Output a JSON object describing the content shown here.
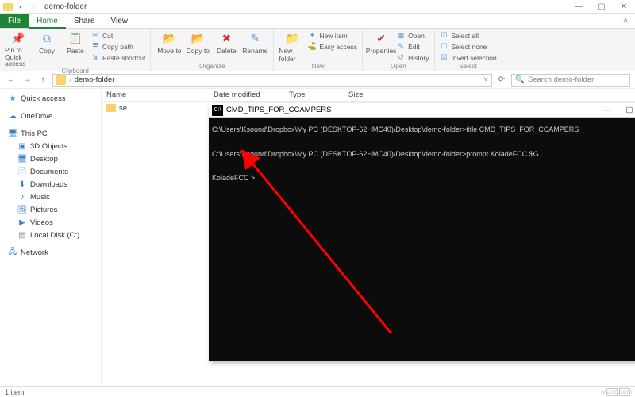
{
  "window": {
    "title": "demo-folder"
  },
  "ribbon": {
    "tabs": {
      "file": "File",
      "home": "Home",
      "share": "Share",
      "view": "View"
    },
    "clipboard": {
      "pin": "Pin to Quick access",
      "copy": "Copy",
      "paste": "Paste",
      "cut": "Cut",
      "copy_path": "Copy path",
      "paste_shortcut": "Paste shortcut",
      "label": "Clipboard"
    },
    "organize": {
      "move": "Move to",
      "copy": "Copy to",
      "delete": "Delete",
      "rename": "Rename",
      "label": "Organize"
    },
    "new": {
      "folder": "New folder",
      "item": "New item",
      "easy": "Easy access",
      "label": "New"
    },
    "open": {
      "properties": "Properties",
      "open": "Open",
      "edit": "Edit",
      "history": "History",
      "label": "Open"
    },
    "select": {
      "all": "Select all",
      "none": "Select none",
      "invert": "Invert selection",
      "label": "Select"
    }
  },
  "address": {
    "path": "demo-folder",
    "search_placeholder": "Search demo-folder"
  },
  "columns": {
    "name": "Name",
    "date": "Date modified",
    "type": "Type",
    "size": "Size"
  },
  "nav": {
    "quick": "Quick access",
    "onedrive": "OneDrive",
    "pc": "This PC",
    "items": [
      "3D Objects",
      "Desktop",
      "Documents",
      "Downloads",
      "Music",
      "Pictures",
      "Videos",
      "Local Disk (C:)"
    ],
    "network": "Network"
  },
  "files": {
    "row0": "se"
  },
  "cmd": {
    "title": "CMD_TIPS_FOR_CCAMPERS",
    "line1": "C:\\Users\\Ksound\\Dropbox\\My PC (DESKTOP-62HMC40)\\Desktop\\demo-folder>title CMD_TIPS_FOR_CCAMPERS",
    "line2": "C:\\Users\\Ksound\\Dropbox\\My PC (DESKTOP-62HMC40)\\Desktop\\demo-folder>prompt KoladeFCC $G",
    "line3": "KoladeFCC >"
  },
  "status": {
    "text": "1 item"
  },
  "watermark": "wsxsn.com"
}
